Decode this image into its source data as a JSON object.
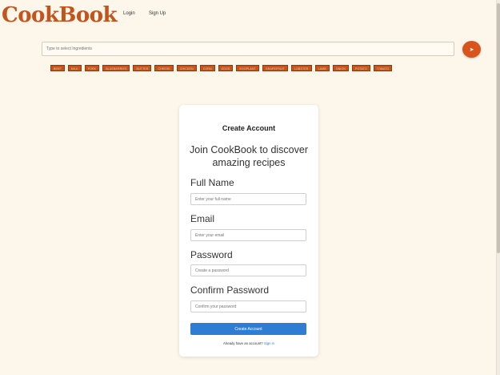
{
  "header": {
    "logo": "CookBook",
    "nav": {
      "login": "Login",
      "signup": "Sign Up"
    }
  },
  "search": {
    "placeholder": "Type to select Ingredients",
    "button_icon": "send-arrow-icon",
    "button_glyph": "➤"
  },
  "ingredients": [
    "BEEF",
    "MILK",
    "PORK",
    "BLUEBERRIES",
    "BUTTER",
    "CHEESE",
    "CHICKEN",
    "CORN",
    "EGGS",
    "EGGPLANT",
    "GRAPEFRUIT",
    "LOBSTER",
    "LAMB",
    "ONION",
    "POTATO",
    "TOMATO"
  ],
  "form": {
    "title": "Create Account",
    "subtitle": "Join CookBook to discover amazing recipes",
    "fields": [
      {
        "label": "Full Name",
        "placeholder": "Enter your full name"
      },
      {
        "label": "Email",
        "placeholder": "Enter your email"
      },
      {
        "label": "Password",
        "placeholder": "Create a password"
      },
      {
        "label": "Confirm Password",
        "placeholder": "Confirm your password"
      }
    ],
    "submit": "Create Account",
    "signin_prompt": "Already have an account?",
    "signin_link": "Sign in"
  },
  "colors": {
    "brand": "#c2541c",
    "accent": "#2f7dd3",
    "background": "#fdf6ea"
  }
}
